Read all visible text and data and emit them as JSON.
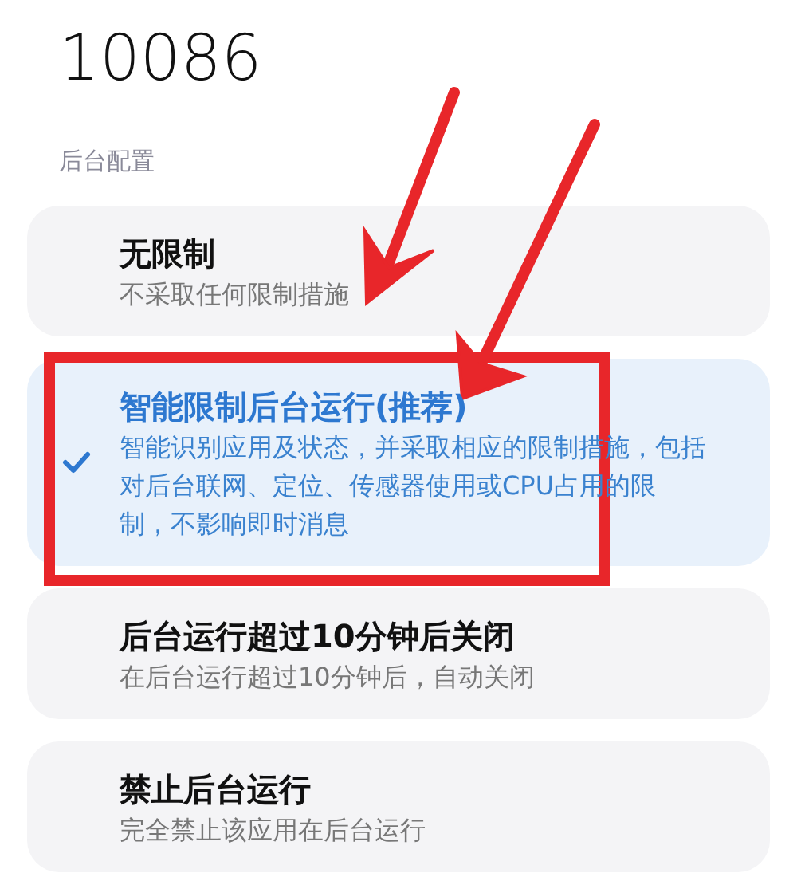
{
  "title": "10086",
  "section_label": "后台配置",
  "options": [
    {
      "title": "无限制",
      "description": "不采取任何限制措施",
      "selected": false
    },
    {
      "title": "智能限制后台运行(推荐)",
      "description": "智能识别应用及状态，并采取相应的限制措施，包括对后台联网、定位、传感器使用或CPU占用的限制，不影响即时消息",
      "selected": true
    },
    {
      "title": "后台运行超过10分钟后关闭",
      "description": "在后台运行超过10分钟后，自动关闭",
      "selected": false
    },
    {
      "title": "禁止后台运行",
      "description": "完全禁止该应用在后台运行",
      "selected": false
    }
  ]
}
